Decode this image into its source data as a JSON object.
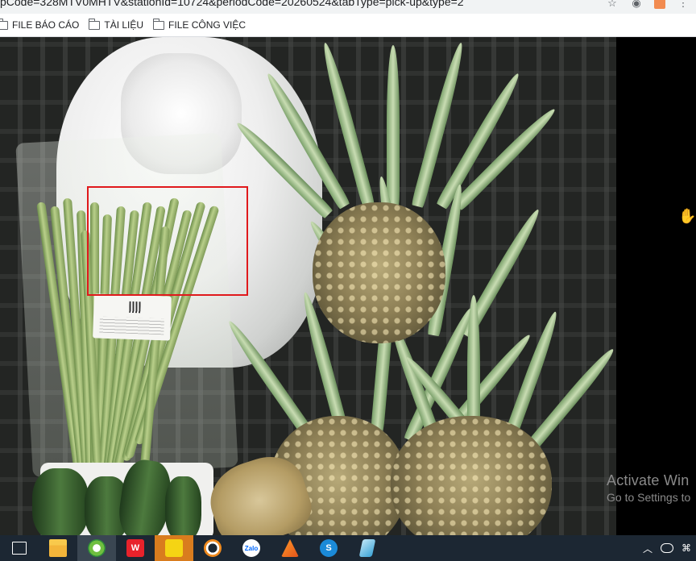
{
  "browser": {
    "url_fragment": "pCode=328MTV0MHTV&stationId=10724&periodCode=20260524&tabType=pick-up&type=2",
    "bookmarks": [
      {
        "label": "FILE BÁO CÁO"
      },
      {
        "label": "TÀI LIỆU"
      },
      {
        "label": "FILE CÔNG VIỆC"
      }
    ]
  },
  "watermark": {
    "line1": "Activate Win",
    "line2": "Go to Settings to"
  },
  "colors": {
    "selection_box": "#e0191c",
    "taskbar": "#1c2733"
  },
  "taskbar": {
    "items": [
      {
        "icon": "task-view-icon",
        "glyph": "⧉"
      },
      {
        "icon": "file-explorer-icon",
        "glyph": ""
      },
      {
        "icon": "coccoc-browser-icon",
        "glyph": ""
      },
      {
        "icon": "wps-office-icon",
        "glyph": "W"
      },
      {
        "icon": "sticky-notes-icon",
        "glyph": ""
      },
      {
        "icon": "ultraviewer-icon",
        "glyph": ""
      },
      {
        "icon": "zalo-icon",
        "glyph": "Zalo"
      },
      {
        "icon": "app-orange-icon",
        "glyph": ""
      },
      {
        "icon": "skype-icon",
        "glyph": "S"
      },
      {
        "icon": "app-blue-icon",
        "glyph": ""
      }
    ]
  }
}
